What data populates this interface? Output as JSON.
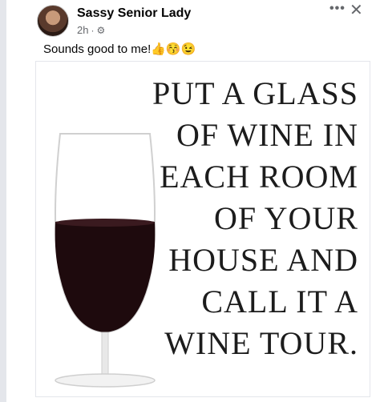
{
  "post": {
    "author": "Sassy Senior Lady",
    "time": "2h",
    "separator": "·",
    "privacy_icon": "gear-icon",
    "more_label": "•••",
    "close_label": "✕",
    "caption": "Sounds good to me!👍😚😉"
  },
  "image": {
    "quote_lines": [
      "PUT A GLASS",
      "OF WINE IN",
      "EACH ROOM",
      "OF YOUR",
      "HOUSE AND",
      "CALL IT A",
      "WINE TOUR."
    ]
  }
}
